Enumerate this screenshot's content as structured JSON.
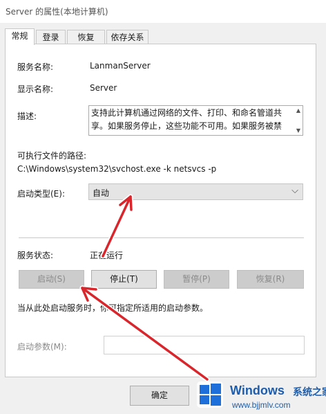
{
  "window": {
    "title": "Server 的属性(本地计算机)"
  },
  "tabs": [
    {
      "label": "常规",
      "active": true
    },
    {
      "label": "登录",
      "active": false
    },
    {
      "label": "恢复",
      "active": false
    },
    {
      "label": "依存关系",
      "active": false
    }
  ],
  "general": {
    "service_name_label": "服务名称:",
    "service_name_value": "LanmanServer",
    "display_name_label": "显示名称:",
    "display_name_value": "Server",
    "description_label": "描述:",
    "description_value": "支持此计算机通过网络的文件、打印、和命名管道共享。如果服务停止，这些功能不可用。如果服务被禁用，",
    "path_label": "可执行文件的路径:",
    "path_value": "C:\\Windows\\system32\\svchost.exe -k netsvcs -p",
    "startup_type_label": "启动类型(E):",
    "startup_type_value": "自动",
    "status_label": "服务状态:",
    "status_value": "正在运行",
    "buttons": {
      "start": "启动(S)",
      "stop": "停止(T)",
      "pause": "暂停(P)",
      "resume": "恢复(R)"
    },
    "hint": "当从此处启动服务时，你可指定所适用的启动参数。",
    "param_label": "启动参数(M):",
    "param_value": ""
  },
  "footer": {
    "ok_label": "确定"
  },
  "watermark": {
    "brand": "Windows",
    "brand_cn": "系统之家",
    "url": "www.bjjmlv.com"
  },
  "colors": {
    "annotation_arrow": "#d9262c",
    "watermark_blue": "#1e5dab"
  },
  "icons": {
    "scroll_up": "▲",
    "scroll_down": "▼",
    "chevron": "⌵"
  }
}
